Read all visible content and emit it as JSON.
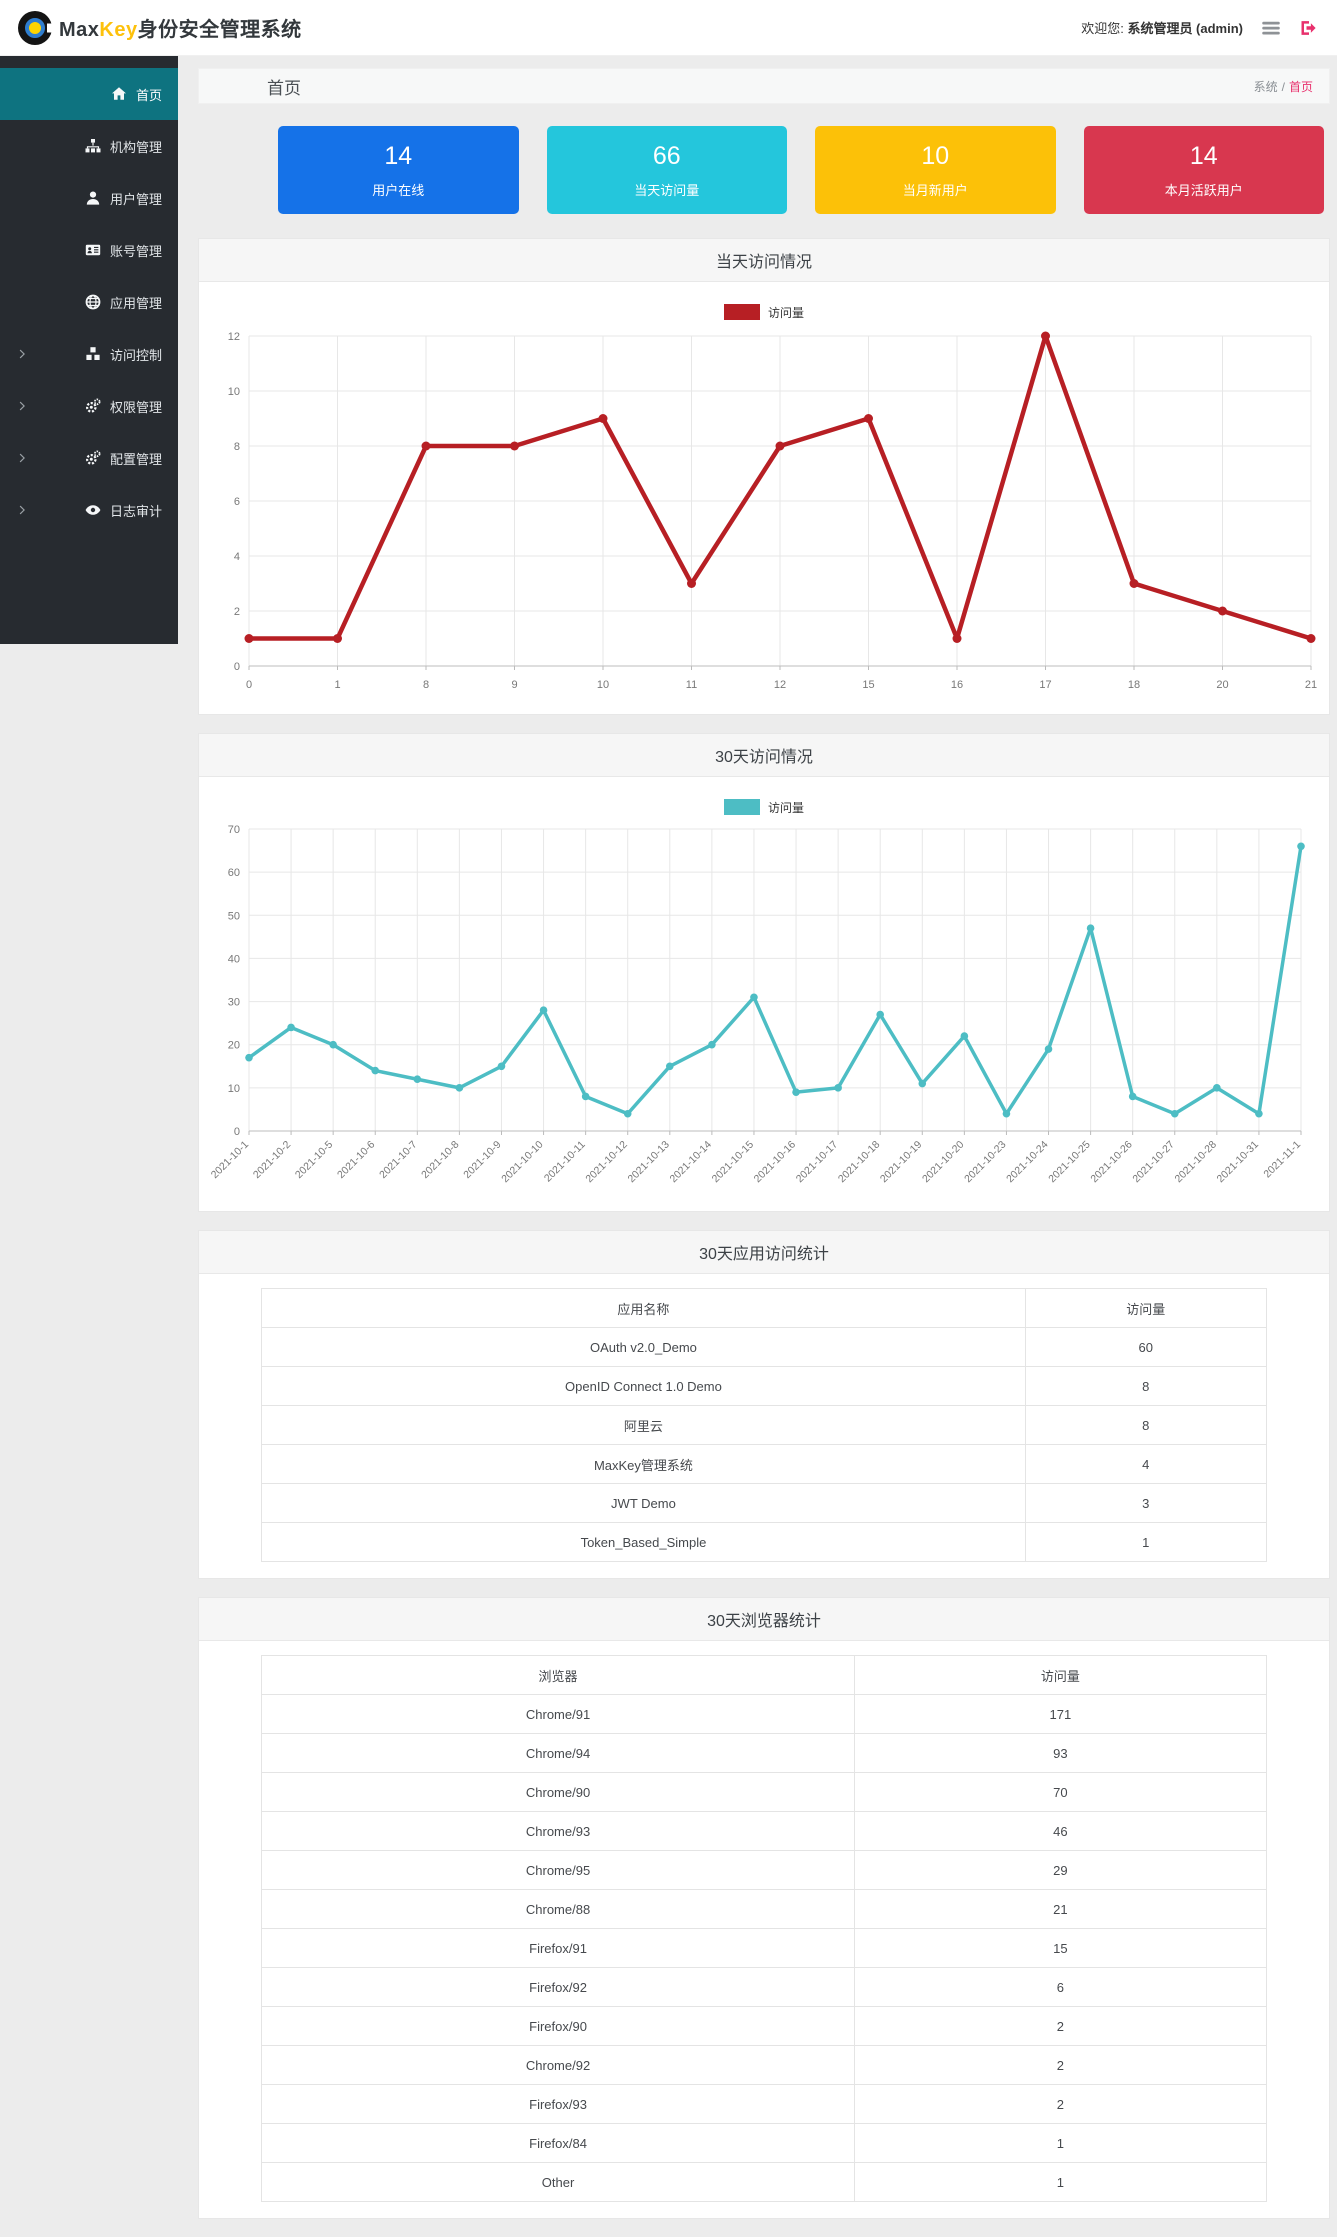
{
  "header": {
    "brand": {
      "max": "Max",
      "key": "Key",
      "suffix": "身份安全管理系统"
    },
    "welcome_label": "欢迎您:",
    "welcome_user": "系统管理员 (admin)"
  },
  "sidebar": {
    "items": [
      {
        "label": "首页",
        "icon": "home-icon",
        "active": true,
        "expandable": false
      },
      {
        "label": "机构管理",
        "icon": "sitemap-icon",
        "active": false,
        "expandable": false
      },
      {
        "label": "用户管理",
        "icon": "user-icon",
        "active": false,
        "expandable": false
      },
      {
        "label": "账号管理",
        "icon": "id-card-icon",
        "active": false,
        "expandable": false
      },
      {
        "label": "应用管理",
        "icon": "globe-icon",
        "active": false,
        "expandable": false
      },
      {
        "label": "访问控制",
        "icon": "cubes-icon",
        "active": false,
        "expandable": true
      },
      {
        "label": "权限管理",
        "icon": "cogs-icon",
        "active": false,
        "expandable": true
      },
      {
        "label": "配置管理",
        "icon": "cogs-icon",
        "active": false,
        "expandable": true
      },
      {
        "label": "日志审计",
        "icon": "eye-icon",
        "active": false,
        "expandable": true
      }
    ]
  },
  "page": {
    "title": "首页",
    "breadcrumb": {
      "root": "系统",
      "separator": "/",
      "current": "首页"
    }
  },
  "stats": [
    {
      "value": "14",
      "label": "用户在线",
      "color": "#1572e8"
    },
    {
      "value": "66",
      "label": "当天访问量",
      "color": "#24c6dc"
    },
    {
      "value": "10",
      "label": "当月新用户",
      "color": "#fcc108"
    },
    {
      "value": "14",
      "label": "本月活跃用户",
      "color": "#d8374f"
    }
  ],
  "chart_data": [
    {
      "type": "line",
      "title": "当天访问情况",
      "legend": "访问量",
      "color": "#b71f24",
      "categories": [
        "0",
        "1",
        "8",
        "9",
        "10",
        "11",
        "12",
        "15",
        "16",
        "17",
        "18",
        "20",
        "21"
      ],
      "values": [
        1,
        1,
        8,
        8,
        9,
        3,
        8,
        9,
        1,
        12,
        3,
        2,
        1
      ],
      "xlabel": "",
      "ylabel": "",
      "ylim": [
        0,
        12
      ],
      "ytick": 2,
      "grid": true,
      "legend_position": "top"
    },
    {
      "type": "line",
      "title": "30天访问情况",
      "legend": "访问量",
      "color": "#4dbdc4",
      "categories": [
        "2021-10-1",
        "2021-10-2",
        "2021-10-5",
        "2021-10-6",
        "2021-10-7",
        "2021-10-8",
        "2021-10-9",
        "2021-10-10",
        "2021-10-11",
        "2021-10-12",
        "2021-10-13",
        "2021-10-14",
        "2021-10-15",
        "2021-10-16",
        "2021-10-17",
        "2021-10-18",
        "2021-10-19",
        "2021-10-20",
        "2021-10-23",
        "2021-10-24",
        "2021-10-25",
        "2021-10-26",
        "2021-10-27",
        "2021-10-28",
        "2021-10-31",
        "2021-11-1"
      ],
      "values": [
        17,
        24,
        20,
        14,
        12,
        10,
        15,
        28,
        8,
        4,
        15,
        20,
        31,
        9,
        10,
        27,
        11,
        22,
        4,
        19,
        47,
        8,
        4,
        10,
        4,
        66
      ],
      "xlabel": "",
      "ylabel": "",
      "ylim": [
        0,
        70
      ],
      "ytick": 10,
      "grid": true,
      "legend_position": "top",
      "rotate_labels": 45
    }
  ],
  "tables": [
    {
      "title": "30天应用访问统计",
      "headers": [
        "应用名称",
        "访问量"
      ],
      "rows": [
        [
          "OAuth v2.0_Demo",
          "60"
        ],
        [
          "OpenID Connect 1.0 Demo",
          "8"
        ],
        [
          "阿里云",
          "8"
        ],
        [
          "MaxKey管理系统",
          "4"
        ],
        [
          "JWT Demo",
          "3"
        ],
        [
          "Token_Based_Simple",
          "1"
        ]
      ]
    },
    {
      "title": "30天浏览器统计",
      "headers": [
        "浏览器",
        "访问量"
      ],
      "rows": [
        [
          "Chrome/91",
          "171"
        ],
        [
          "Chrome/94",
          "93"
        ],
        [
          "Chrome/90",
          "70"
        ],
        [
          "Chrome/93",
          "46"
        ],
        [
          "Chrome/95",
          "29"
        ],
        [
          "Chrome/88",
          "21"
        ],
        [
          "Firefox/91",
          "15"
        ],
        [
          "Firefox/92",
          "6"
        ],
        [
          "Firefox/90",
          "2"
        ],
        [
          "Chrome/92",
          "2"
        ],
        [
          "Firefox/93",
          "2"
        ],
        [
          "Firefox/84",
          "1"
        ],
        [
          "Other",
          "1"
        ]
      ]
    }
  ]
}
